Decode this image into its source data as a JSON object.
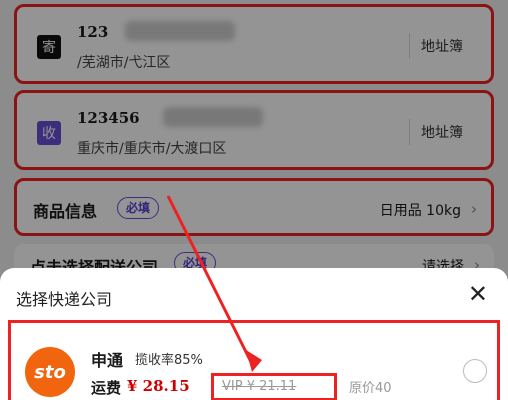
{
  "sender": {
    "badge": "寄",
    "name": "123",
    "address": "/芜湖市/弋江区",
    "book": "地址簿"
  },
  "receiver": {
    "badge": "收",
    "name": "123456",
    "address": "重庆市/重庆市/大渡口区",
    "book": "地址簿"
  },
  "goods": {
    "title": "商品信息",
    "required": "必填",
    "value": "日用品 10kg"
  },
  "choose": {
    "title": "点击选择配送公司",
    "required": "必填",
    "action": "请选择"
  },
  "sheet": {
    "title": "选择快递公司",
    "option": {
      "logo": "sto",
      "name": "申通",
      "rate": "揽收率85%",
      "fee_label": "运费",
      "fee": "¥ 28.15",
      "vip": "VIP ¥ 21.11",
      "original": "原价40"
    }
  },
  "colors": {
    "highlight": "#ee2222",
    "accent": "#6a4fd8",
    "sto": "#f0650e"
  },
  "icons": {
    "close": "close-icon",
    "chevron": "chevron-right-icon"
  }
}
